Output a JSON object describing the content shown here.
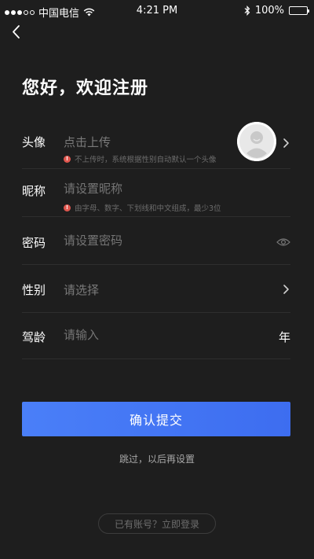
{
  "status_bar": {
    "carrier": "中国电信",
    "time": "4:21 PM",
    "battery": "100%",
    "icons": [
      "signal-dots-icon",
      "wifi-icon",
      "bluetooth-icon",
      "battery-icon"
    ]
  },
  "header": {
    "back_icon": "chevron-left-icon",
    "title": "您好，欢迎注册"
  },
  "form": {
    "avatar": {
      "label": "头像",
      "placeholder": "点击上传",
      "hint": "不上传时，系统根据性别自动默认一个头像",
      "icon": "chevron-right-icon"
    },
    "nickname": {
      "label": "昵称",
      "placeholder": "请设置昵称",
      "hint": "由字母、数字、下划线和中文组成，最少3位"
    },
    "password": {
      "label": "密码",
      "placeholder": "请设置密码",
      "icon": "eye-icon"
    },
    "gender": {
      "label": "性别",
      "placeholder": "请选择",
      "icon": "chevron-right-icon"
    },
    "driving_years": {
      "label": "驾龄",
      "placeholder": "请输入",
      "unit": "年"
    }
  },
  "actions": {
    "submit_label": "确认提交",
    "skip_label": "跳过，以后再设置",
    "login_label": "已有账号？立即登录"
  },
  "colors": {
    "background": "#1e1e1e",
    "accent": "#4a7ff8",
    "hint_dot": "#e0574f"
  }
}
